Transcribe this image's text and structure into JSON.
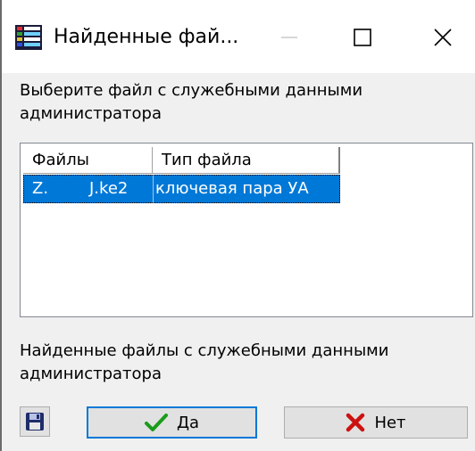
{
  "window": {
    "title": "Найденные фай...",
    "icon": "file-list-icon",
    "controls": [
      "minimize-icon",
      "maximize-icon",
      "close-icon"
    ]
  },
  "prompt": "Выберите файл с служебными данными администратора",
  "table": {
    "columns": [
      "Файлы",
      "Тип файла"
    ],
    "rows": [
      {
        "file_part1": "Z.",
        "file_part2": "J.ke2",
        "type": "ключевая пара УА",
        "selected": true
      }
    ]
  },
  "found_label": "Найденные файлы с служебными данными администратора",
  "buttons": {
    "save_icon": "floppy-disk-icon",
    "yes_label": "Да",
    "yes_icon": "checkmark-icon",
    "no_label": "Нет",
    "no_icon": "red-x-icon"
  },
  "colors": {
    "selection": "#0078d7",
    "checkmark": "#1a9c1a",
    "cross": "#cc1111"
  }
}
